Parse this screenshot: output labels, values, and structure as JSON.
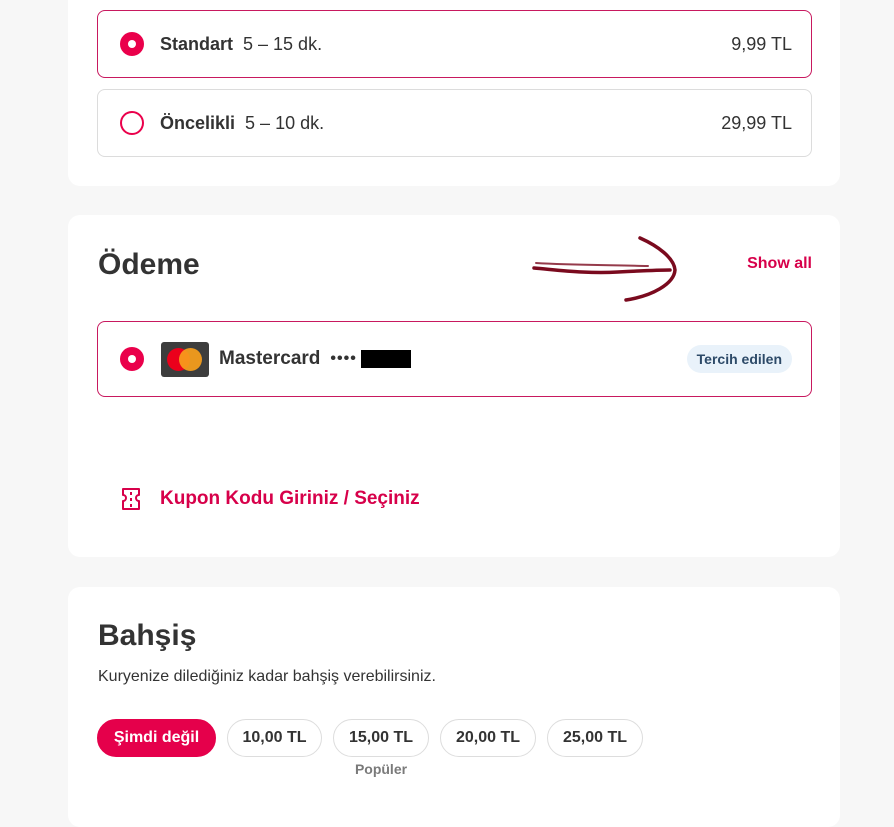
{
  "delivery": {
    "options": [
      {
        "name": "Standart",
        "time": "5 – 15 dk.",
        "price": "9,99 TL",
        "selected": true
      },
      {
        "name": "Öncelikli",
        "time": "5 – 10 dk.",
        "price": "29,99 TL",
        "selected": false
      }
    ]
  },
  "payment": {
    "title": "Ödeme",
    "show_all": "Show all",
    "card": {
      "brand": "Mastercard",
      "masked": "••••",
      "badge": "Tercih edilen",
      "selected": true
    },
    "coupon_label": "Kupon Kodu Giriniz / Seçiniz"
  },
  "tip": {
    "title": "Bahşiş",
    "subtitle": "Kuryenize dilediğiniz kadar bahşiş verebilirsiniz.",
    "options": [
      {
        "label": "Şimdi değil",
        "active": true
      },
      {
        "label": "10,00 TL",
        "active": false
      },
      {
        "label": "15,00 TL",
        "active": false,
        "note": "Popüler"
      },
      {
        "label": "20,00 TL",
        "active": false
      },
      {
        "label": "25,00 TL",
        "active": false
      }
    ]
  },
  "colors": {
    "accent": "#ea004b",
    "link": "#d7004a",
    "arrow": "#7a0a1e",
    "badge_bg": "#e9f2fa"
  }
}
